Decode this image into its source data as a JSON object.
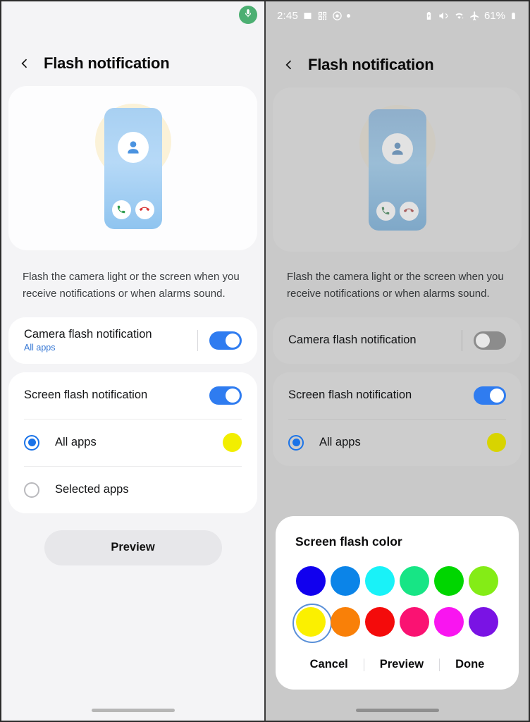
{
  "left": {
    "mic_badge_icon": "microphone-icon",
    "appbar": {
      "back_icon": "back-chevron-icon",
      "title": "Flash notification"
    },
    "illustration": {
      "avatar_icon": "person-avatar-icon",
      "accept_icon": "phone-accept-icon",
      "reject_icon": "phone-reject-icon"
    },
    "description": "Flash the camera light or the screen when you receive notifications or when alarms sound.",
    "camera_row": {
      "title": "Camera flash notification",
      "subtitle": "All apps",
      "toggle_state": "on"
    },
    "screen_row": {
      "title": "Screen flash notification",
      "toggle_state": "on"
    },
    "all_apps_row": {
      "label": "All apps",
      "selected": true,
      "color": "#f2ee00"
    },
    "selected_apps_row": {
      "label": "Selected apps",
      "selected": false
    },
    "preview_button": "Preview"
  },
  "right": {
    "statusbar": {
      "time": "2:45",
      "left_icons": [
        "image-icon",
        "qr-code-icon",
        "target-icon",
        "dot-icon"
      ],
      "right_icons": [
        "battery-saver-icon",
        "mute-icon",
        "wifi-icon",
        "airplane-mode-icon"
      ],
      "battery_percent": "61%",
      "battery_icon": "battery-icon"
    },
    "appbar": {
      "back_icon": "back-chevron-icon",
      "title": "Flash notification"
    },
    "illustration": {
      "avatar_icon": "person-avatar-icon",
      "accept_icon": "phone-accept-icon",
      "reject_icon": "phone-reject-icon"
    },
    "description": "Flash the camera light or the screen when you receive notifications or when alarms sound.",
    "camera_row": {
      "title": "Camera flash notification",
      "toggle_state": "off"
    },
    "screen_row": {
      "title": "Screen flash notification",
      "toggle_state": "on"
    },
    "all_apps_row": {
      "label": "All apps",
      "selected": true,
      "color": "#d8d400"
    },
    "dialog": {
      "title": "Screen flash color",
      "colors": [
        {
          "name": "blue",
          "hex": "#1100ee",
          "selected": false
        },
        {
          "name": "azure",
          "hex": "#0b84e8",
          "selected": false
        },
        {
          "name": "cyan",
          "hex": "#19f2f8",
          "selected": false
        },
        {
          "name": "spring-green",
          "hex": "#17e585",
          "selected": false
        },
        {
          "name": "green",
          "hex": "#00d600",
          "selected": false
        },
        {
          "name": "lime",
          "hex": "#84ec16",
          "selected": false
        },
        {
          "name": "yellow",
          "hex": "#fbf000",
          "selected": true
        },
        {
          "name": "orange",
          "hex": "#f98008",
          "selected": false
        },
        {
          "name": "red",
          "hex": "#f40b0b",
          "selected": false
        },
        {
          "name": "pink",
          "hex": "#fa1272",
          "selected": false
        },
        {
          "name": "magenta",
          "hex": "#f915f0",
          "selected": false
        },
        {
          "name": "violet",
          "hex": "#7a13e4",
          "selected": false
        }
      ],
      "cancel": "Cancel",
      "preview": "Preview",
      "done": "Done"
    }
  }
}
